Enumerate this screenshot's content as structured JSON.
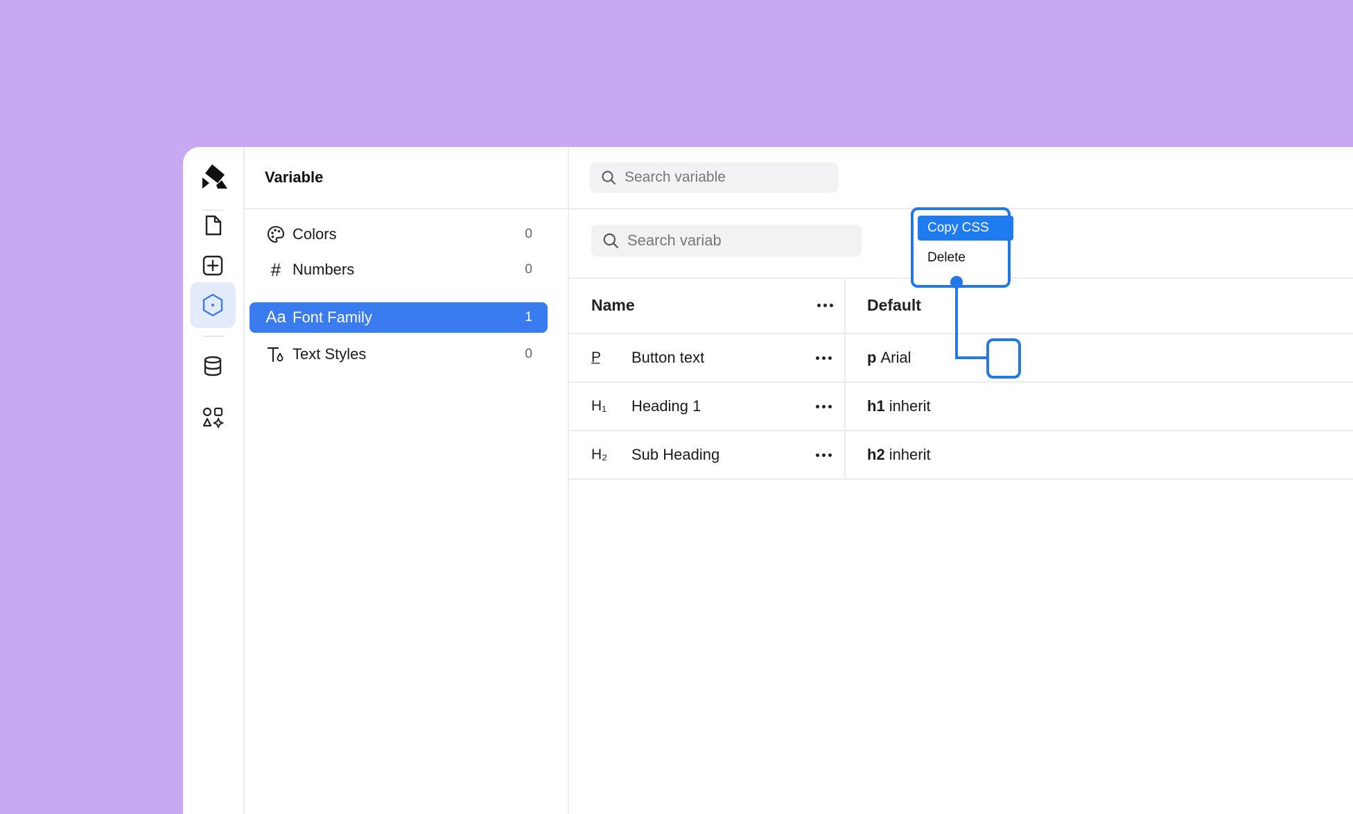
{
  "panel": {
    "title": "Variable",
    "categories": [
      {
        "label": "Colors",
        "count": "0",
        "icon": "palette-icon"
      },
      {
        "label": "Numbers",
        "count": "0",
        "icon": "hash-icon"
      },
      {
        "label": "Font Family",
        "count": "1",
        "icon": "font-aa-icon",
        "active": true
      },
      {
        "label": "Text Styles",
        "count": "0",
        "icon": "text-style-icon"
      }
    ]
  },
  "search": {
    "top_placeholder": "Search variable",
    "secondary_placeholder": "Search variab"
  },
  "table": {
    "header_name": "Name",
    "header_default": "Default",
    "rows": [
      {
        "icon_text": "P̲",
        "name": "Button text",
        "tag": "p",
        "value": "Arial"
      },
      {
        "icon_text": "H₁",
        "name": "Heading 1",
        "tag": "h1",
        "value": "inherit"
      },
      {
        "icon_text": "H₂",
        "name": "Sub Heading",
        "tag": "h2",
        "value": "inherit"
      }
    ]
  },
  "menu": {
    "copy_label": "Copy CSS",
    "delete_label": "Delete"
  },
  "colors": {
    "background": "#c8a8f2",
    "accent": "#3a7bf0",
    "callout": "#2478e6"
  }
}
